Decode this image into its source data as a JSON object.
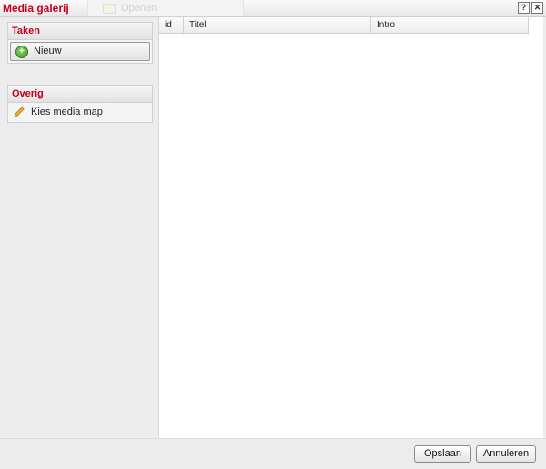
{
  "window": {
    "title": "Media galerij",
    "ghost_toolbar_label": "Openen",
    "help_glyph": "?",
    "close_glyph": "✕"
  },
  "sidebar": {
    "tasks": {
      "header": "Taken",
      "items": [
        {
          "label": "Nieuw",
          "icon": "plus-icon"
        }
      ]
    },
    "other": {
      "header": "Overig",
      "items": [
        {
          "label": "Kies media map",
          "icon": "pencil-icon"
        }
      ]
    }
  },
  "grid": {
    "columns": [
      "id",
      "Titel",
      "Intro"
    ],
    "rows": []
  },
  "footer": {
    "save_label": "Opslaan",
    "cancel_label": "Annuleren"
  },
  "colors": {
    "title": "#c8001e",
    "group_header_text": "#c8001e",
    "background": "#ececec"
  }
}
